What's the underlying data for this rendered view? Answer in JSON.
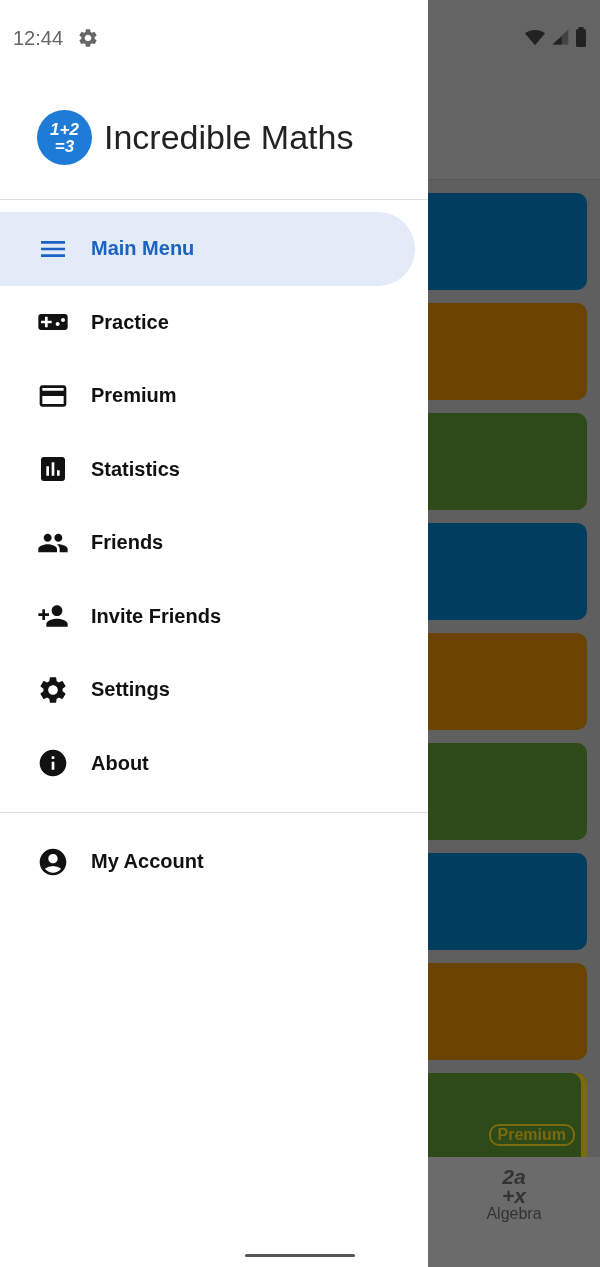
{
  "status_bar": {
    "time": "12:44"
  },
  "drawer": {
    "logo_text": [
      "1+2",
      "=3"
    ],
    "title": "Incredible Maths",
    "items": [
      {
        "label": "Main Menu",
        "kind": "menu",
        "selected": true
      },
      {
        "label": "Practice",
        "kind": "gamepad",
        "selected": false
      },
      {
        "label": "Premium",
        "kind": "card",
        "selected": false
      },
      {
        "label": "Statistics",
        "kind": "chart",
        "selected": false
      },
      {
        "label": "Friends",
        "kind": "people",
        "selected": false
      },
      {
        "label": "Invite Friends",
        "kind": "invite",
        "selected": false
      },
      {
        "label": "Settings",
        "kind": "gear",
        "selected": false
      },
      {
        "label": "About",
        "kind": "info",
        "selected": false
      }
    ],
    "account_items": [
      {
        "label": "My Account",
        "kind": "account",
        "selected": false
      }
    ]
  },
  "background": {
    "cards": [
      {
        "color": "#003d5e"
      },
      {
        "color": "#6a4300"
      },
      {
        "color": "#2e4a19"
      },
      {
        "color": "#003d5e"
      },
      {
        "color": "#6a4300"
      },
      {
        "color": "#2e4a19"
      },
      {
        "color": "#003d5e"
      },
      {
        "color": "#6a4300"
      },
      {
        "color": "#2e4a19",
        "badge": "Premium"
      }
    ],
    "bottom_nav": {
      "icon_lines": [
        "2a",
        "+x"
      ],
      "label": "Algebra"
    }
  }
}
